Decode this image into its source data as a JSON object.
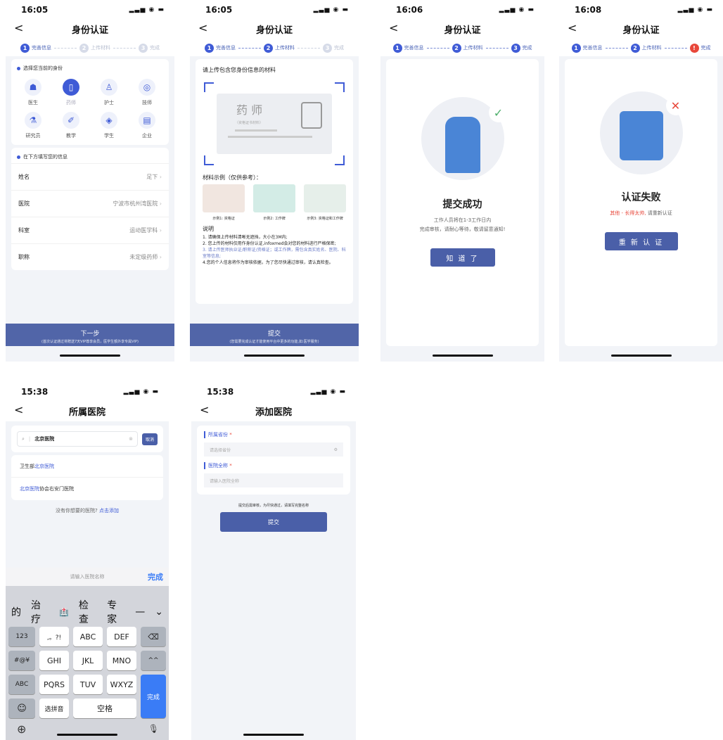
{
  "common": {
    "back": "<"
  },
  "p1": {
    "time": "16:05",
    "signal": "▂▃▅ ◉ ▬",
    "title": "身份认证",
    "steps": [
      "完善信息",
      "上传材料",
      "完成"
    ],
    "select_header": "选择您当前的身份",
    "identities": [
      {
        "label": "医生",
        "icon": "☗"
      },
      {
        "label": "药师",
        "icon": "▯"
      },
      {
        "label": "护士",
        "icon": "♙"
      },
      {
        "label": "技师",
        "icon": "◎"
      },
      {
        "label": "研究员",
        "icon": "⚗"
      },
      {
        "label": "教学",
        "icon": "✐"
      },
      {
        "label": "学生",
        "icon": "◈"
      },
      {
        "label": "企业",
        "icon": "▤"
      }
    ],
    "fill_header": "在下方填写您的信息",
    "fields": [
      {
        "label": "姓名",
        "value": "足下"
      },
      {
        "label": "医院",
        "value": "宁波市杭州湾医院"
      },
      {
        "label": "科室",
        "value": "运动医学科"
      },
      {
        "label": "职称",
        "value": "未定级药师"
      }
    ],
    "next": "下一步",
    "next_sub": "(首次认证通过将赠送7天VIP尊享会员，医学生额外享专属VIP)"
  },
  "p2": {
    "time": "16:05",
    "signal": "▂▃▅ ◉ ▬",
    "title": "身份认证",
    "steps": [
      "完善信息",
      "上传材料",
      "完成"
    ],
    "upload_title": "请上传包含您身份信息的材料",
    "cert_title": "药 师",
    "cert_sub": "（资格证书材料）",
    "examples_title": "材料示例（仅供参考）：",
    "examples": [
      "示例1: 资格证",
      "示例2: 工作牌",
      "示例3: 资格证和工作牌"
    ],
    "notes_title": "说明",
    "notes": [
      "1. 请确保上传材料清晰无遮挡，大小在3M内;",
      "2. 您上传的材料仅用作身份认证,infoxmed会对您的材料进行严格保密;",
      "3. 请上传医师执业证/职称证/资格证；或工作牌，需包含真实姓名、医院、科室等信息;",
      "4.您的个人信息将作为审核依据，为了您尽快通过审核，请认真检查。"
    ],
    "submit": "提交",
    "submit_sub": "(您需要完成认证才能使用平台中更多的功能,如:医学服务)"
  },
  "p3": {
    "time": "16:06",
    "signal": "▂▃▅ ◉ ▬",
    "title": "身份认证",
    "steps": [
      "完善信息",
      "上传材料",
      "完成"
    ],
    "result": "提交成功",
    "line1": "工作人员将在1-3工作日内",
    "line2": "完成审核，请耐心等待，敬请留意通知!",
    "btn": "知 道 了"
  },
  "p4": {
    "time": "16:08",
    "signal": "▂▃▅ ◉ ▬",
    "title": "身份认证",
    "steps": [
      "完善信息",
      "上传材料",
      "完成"
    ],
    "result": "认证失败",
    "reason": "其他 - 长得太帅,",
    "reason2": "请重新认证",
    "btn": "重 新 认 证"
  },
  "p5": {
    "time": "15:38",
    "signal": "▂▃▅ ◉ ▬",
    "title": "所属医院",
    "search_value": "北京医院",
    "cancel": "取消",
    "results": [
      {
        "pre": "卫生部",
        "hl": "北京医院",
        "post": ""
      },
      {
        "pre": "",
        "hl": "北京医院",
        "post": "协会右安门医院"
      }
    ],
    "no_result": "没有你想要的医院?",
    "add_link": "点击添加",
    "input_ph": "请输入医院名称",
    "done": "完成",
    "candidates": [
      "的",
      "治疗",
      "🏥",
      "检查",
      "专家",
      "—",
      "⌄"
    ],
    "keys": {
      "r1": [
        "123",
        ",。?!",
        "ABC",
        "DEF",
        "⌫"
      ],
      "r2": [
        "#@¥",
        "GHI",
        "JKL",
        "MNO",
        "^^"
      ],
      "r3": [
        "ABC",
        "PQRS",
        "TUV",
        "WXYZ"
      ],
      "r4": [
        "☺",
        "选拼音",
        "空格"
      ],
      "enter": "完成",
      "globe": "⊕",
      "mic": "🎙"
    }
  },
  "p6": {
    "time": "15:38",
    "signal": "▂▃▅ ◉ ▬",
    "title": "添加医院",
    "prov_label": "所属省份",
    "prov_ph": "请选择省份",
    "name_label": "医院全称",
    "name_ph": "请输入医院全称",
    "req": "*",
    "tip": "提交后需审核，为尽快通过，请填写完整名称",
    "submit": "提交"
  }
}
